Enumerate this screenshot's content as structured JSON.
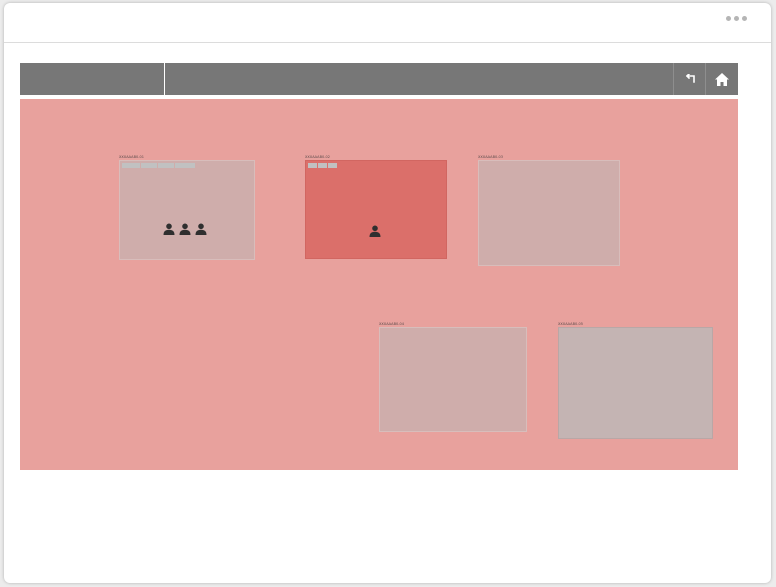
{
  "header": {
    "more_icon": "more-dots-icon"
  },
  "toolbar": {
    "back_icon": "back-arrow-icon",
    "home_icon": "home-icon",
    "background": "#777777"
  },
  "floor": {
    "background": "#e8a19d",
    "rooms": [
      {
        "label": "XXXAAAB0-01",
        "state": "occupied",
        "occupants": 3,
        "fill": "#cfadab"
      },
      {
        "label": "XXXAAAB0-02",
        "state": "alert",
        "occupants": 1,
        "fill": "#db6f6a"
      },
      {
        "label": "XXXAAAB0-03",
        "state": "free",
        "occupants": 0,
        "fill": "#cfadab"
      },
      {
        "label": "XXXAAAB0-04",
        "state": "free",
        "occupants": 0,
        "fill": "#cfadab"
      },
      {
        "label": "XXXAAAB0-05",
        "state": "free",
        "occupants": 0,
        "fill": "#c4b4b3"
      }
    ]
  }
}
